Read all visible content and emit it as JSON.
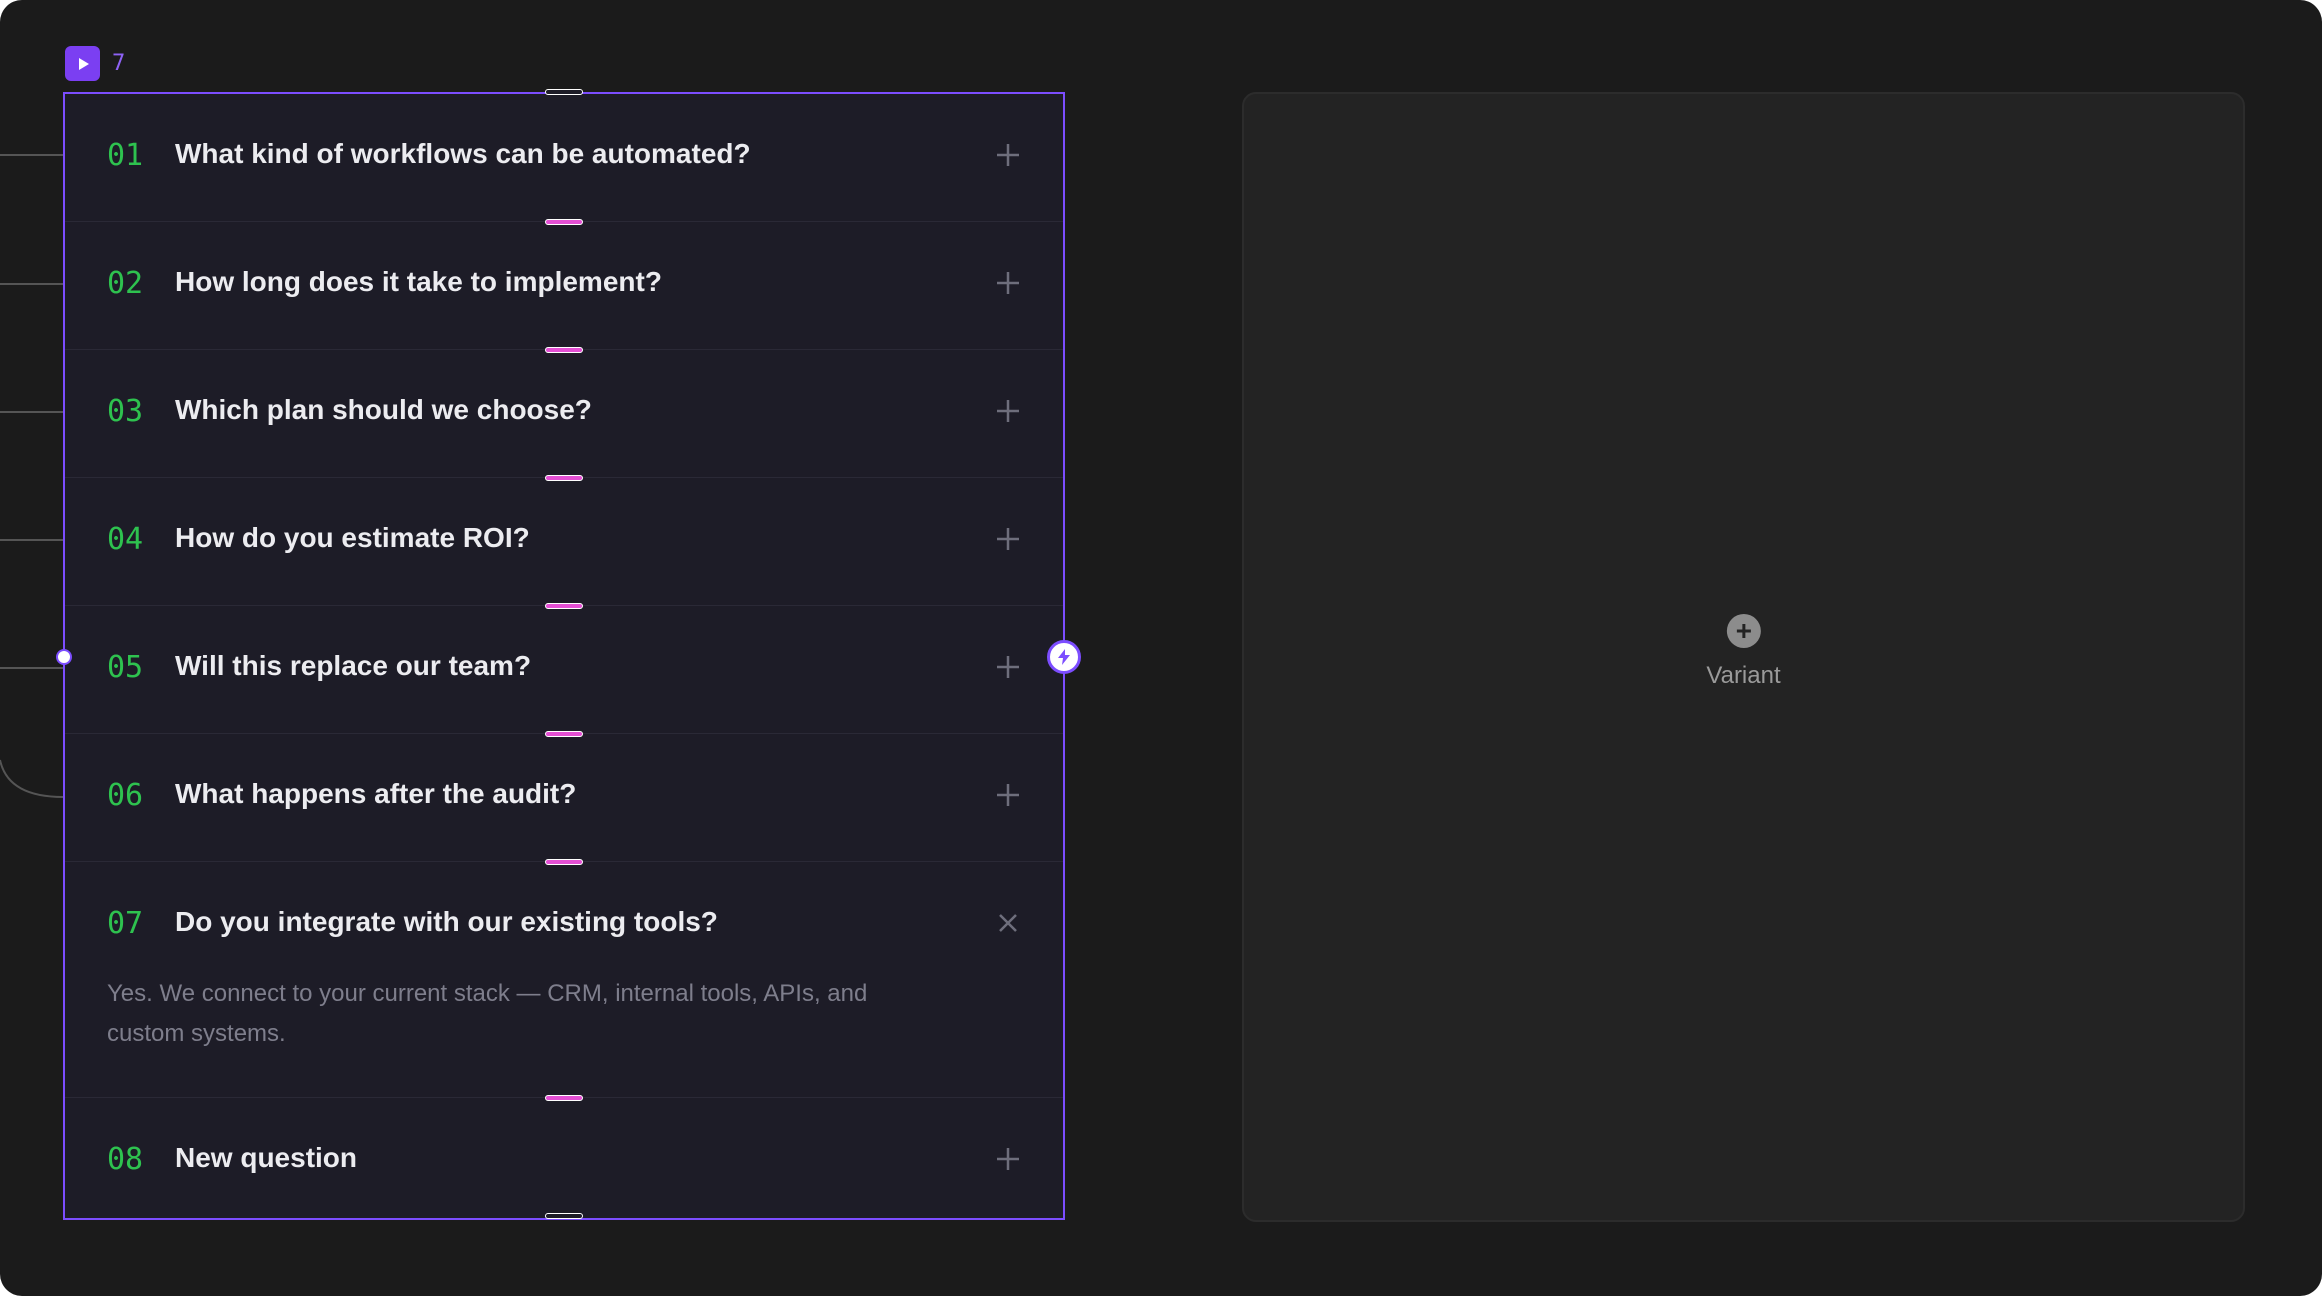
{
  "frame": {
    "badge_icon": "play-icon",
    "count": "7",
    "accent_color": "#7c4dff"
  },
  "faq": {
    "number_color": "#2ec24f",
    "items": [
      {
        "number": "01",
        "question": "What kind of workflows can be automated?",
        "toggle": "plus-icon"
      },
      {
        "number": "02",
        "question": "How long does it take to implement?",
        "toggle": "plus-icon"
      },
      {
        "number": "03",
        "question": "Which plan should we choose?",
        "toggle": "plus-icon"
      },
      {
        "number": "04",
        "question": "How do you estimate ROI?",
        "toggle": "plus-icon"
      },
      {
        "number": "05",
        "question": "Will this replace our team?",
        "toggle": "plus-icon"
      },
      {
        "number": "06",
        "question": "What happens after the audit?",
        "toggle": "plus-icon"
      },
      {
        "number": "07",
        "question": "Do you integrate with our existing tools?",
        "toggle": "close-icon",
        "answer": "Yes. We connect to your current stack — CRM, internal tools, APIs, and custom systems."
      },
      {
        "number": "08",
        "question": "New question",
        "toggle": "plus-icon"
      }
    ]
  },
  "interaction_handle_icon": "lightning-bolt-icon",
  "variant": {
    "label": "Variant",
    "icon": "plus-circle-icon"
  }
}
